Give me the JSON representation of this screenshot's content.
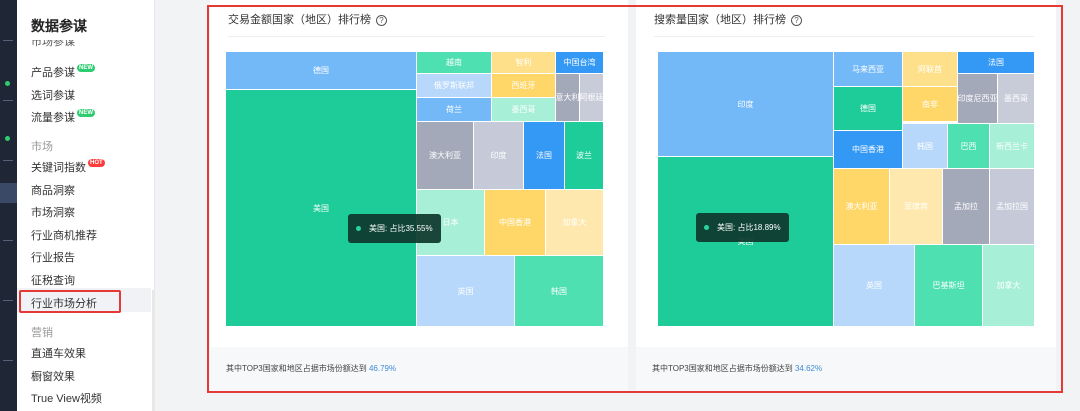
{
  "sidebar": {
    "title": "数据参谋",
    "cut_item": "市场参谋",
    "items": [
      {
        "label": "产品参谋",
        "badge": "NEW"
      },
      {
        "label": "选词参谋",
        "badge": ""
      },
      {
        "label": "流量参谋",
        "badge": "NEW"
      }
    ],
    "group_market": "市场",
    "market_items": [
      {
        "label": "关键词指数",
        "badge": "HOT"
      },
      {
        "label": "商品洞察",
        "badge": ""
      },
      {
        "label": "市场洞察",
        "badge": ""
      },
      {
        "label": "行业商机推荐",
        "badge": ""
      },
      {
        "label": "行业报告",
        "badge": ""
      },
      {
        "label": "征税查询",
        "badge": ""
      },
      {
        "label": "行业市场分析",
        "badge": ""
      }
    ],
    "group_marketing": "营销",
    "marketing_items": [
      {
        "label": "直通车效果"
      },
      {
        "label": "橱窗效果"
      },
      {
        "label": "True View视频"
      }
    ]
  },
  "left_card": {
    "title": "交易金额国家（地区）排行榜",
    "help": "?",
    "tooltip": "美国: 占比35.55%",
    "footer_prefix": "其中TOP3国家和地区占据市场份额达到",
    "footer_pct": "46.79%",
    "tiles": [
      {
        "label": "德国",
        "color": "#74b9f7"
      },
      {
        "label": "美国",
        "color": "#1dcc98"
      },
      {
        "label": "越南",
        "color": "#4fe0b2"
      },
      {
        "label": "智利",
        "color": "#ffe08a"
      },
      {
        "label": "中国台湾",
        "color": "#3498f5"
      },
      {
        "label": "俄罗斯联邦",
        "color": "#b8d8fb"
      },
      {
        "label": "西班牙",
        "color": "#ffd668"
      },
      {
        "label": "意大利",
        "color": "#a4a9ba"
      },
      {
        "label": "阿根廷",
        "color": "#c8ccd8"
      },
      {
        "label": "荷兰",
        "color": "#74b9f7"
      },
      {
        "label": "墨西哥",
        "color": "#a7efd6"
      },
      {
        "label": "澳大利亚",
        "color": "#a4a9ba"
      },
      {
        "label": "印度",
        "color": "#c6cad8"
      },
      {
        "label": "法国",
        "color": "#3498f5"
      },
      {
        "label": "波兰",
        "color": "#1dcc98"
      },
      {
        "label": "日本",
        "color": "#a7efd6"
      },
      {
        "label": "中国香港",
        "color": "#ffd668"
      },
      {
        "label": "加拿大",
        "color": "#ffe8ad"
      },
      {
        "label": "英国",
        "color": "#b8d8fb"
      },
      {
        "label": "韩国",
        "color": "#4fe0b2"
      }
    ]
  },
  "right_card": {
    "title": "搜索量国家（地区）排行榜",
    "help": "?",
    "tooltip": "美国: 占比18.89%",
    "footer_prefix": "其中TOP3国家和地区占据市场份额达到",
    "footer_pct": "34.62%",
    "tiles": [
      {
        "label": "印度",
        "color": "#74b9f7"
      },
      {
        "label": "美国",
        "color": "#1dcc98"
      },
      {
        "label": "马来西亚",
        "color": "#74b9f7"
      },
      {
        "label": "阿联酋",
        "color": "#ffe08a"
      },
      {
        "label": "法国",
        "color": "#3498f5"
      },
      {
        "label": "德国",
        "color": "#1dcc98"
      },
      {
        "label": "南非",
        "color": "#ffd668"
      },
      {
        "label": "印度尼西亚",
        "color": "#a4a9ba"
      },
      {
        "label": "墨西哥",
        "color": "#c8ccd8"
      },
      {
        "label": "中国香港",
        "color": "#3498f5"
      },
      {
        "label": "韩国",
        "color": "#b8d8fb"
      },
      {
        "label": "巴西",
        "color": "#4fe0b2"
      },
      {
        "label": "新西兰卡",
        "color": "#a7efd6"
      },
      {
        "label": "澳大利亚",
        "color": "#ffd668"
      },
      {
        "label": "菲律宾",
        "color": "#ffe8ad"
      },
      {
        "label": "孟加拉",
        "color": "#a4a9ba"
      },
      {
        "label": "孟加拉国",
        "color": "#c6cad8"
      },
      {
        "label": "英国",
        "color": "#b8d8fb"
      },
      {
        "label": "巴基斯坦",
        "color": "#4fe0b2"
      },
      {
        "label": "加拿大",
        "color": "#a7efd6"
      }
    ]
  }
}
